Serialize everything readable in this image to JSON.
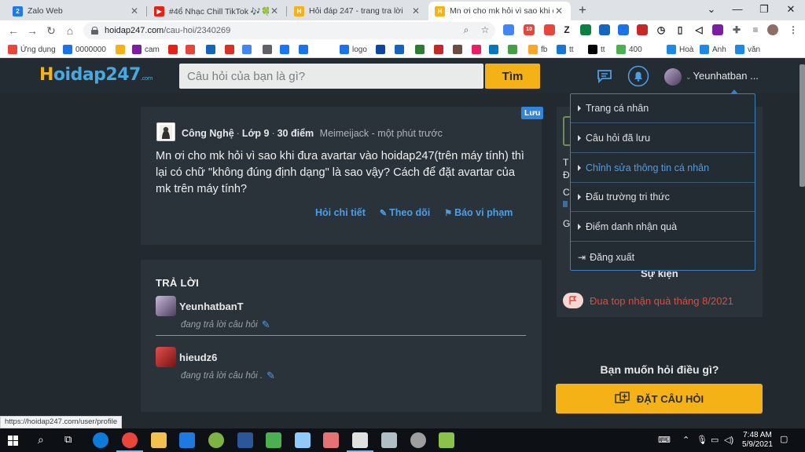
{
  "browser": {
    "tabs": [
      {
        "title": "Zalo Web",
        "favicon_color": "#1e7ae6",
        "favicon_badge": "2",
        "active": false
      },
      {
        "title": "#46̀ Nhạc Chill TikTok 🎶🍀 Đ",
        "favicon_color": "#e62117",
        "active": false
      },
      {
        "title": "Hỏi đáp 247 - trang tra lời",
        "favicon_color": "#f5b217",
        "active": false
      },
      {
        "title": "Mn ơi cho mk hỏi vì sao khi đưa",
        "favicon_color": "#f5b217",
        "active": true
      }
    ],
    "new_tab_symbol": "+",
    "window_controls": {
      "minimize": "—",
      "maximize": "❐",
      "close": "✕"
    },
    "address": {
      "domain": "hoidap247.com",
      "path": "/cau-hoi/2340269"
    },
    "extension_badge": "10"
  },
  "bookmarks": [
    {
      "label": "Ứng dụng",
      "color": "#e8453c"
    },
    {
      "label": "0000000",
      "color": "#1a73e8"
    },
    {
      "label": "",
      "color": "#f5b217"
    },
    {
      "label": "cam",
      "color": "#7b1fa2"
    },
    {
      "label": "",
      "color": "#e62117"
    },
    {
      "label": "",
      "color": "#e8453c"
    },
    {
      "label": "",
      "color": "#1565c0"
    },
    {
      "label": "",
      "color": "#d93025"
    },
    {
      "label": "",
      "color": "#4285f4"
    },
    {
      "label": "",
      "color": "#5f6368"
    },
    {
      "label": "",
      "color": "#1877f2"
    },
    {
      "label": "",
      "color": "#1a73e8"
    },
    {
      "label": "logo",
      "color": "#1a73e8"
    },
    {
      "label": "",
      "color": "#0d47a1"
    },
    {
      "label": "",
      "color": "#1565c0"
    },
    {
      "label": "",
      "color": "#2e7d32"
    },
    {
      "label": "",
      "color": "#c62828"
    },
    {
      "label": "",
      "color": "#6d4c41"
    },
    {
      "label": "",
      "color": "#e91e63"
    },
    {
      "label": "",
      "color": "#0277bd"
    },
    {
      "label": "",
      "color": "#43a047"
    },
    {
      "label": "fb",
      "color": "#f9a825"
    },
    {
      "label": "tt",
      "color": "#1976d2"
    },
    {
      "label": "tt",
      "color": "#000000"
    },
    {
      "label": "400",
      "color": "#4caf50"
    },
    {
      "label": "Hoà",
      "color": "#1e88e5"
    },
    {
      "label": "Anh",
      "color": "#1e88e5"
    },
    {
      "label": "văn",
      "color": "#1e88e5"
    }
  ],
  "site": {
    "logo": {
      "h": "H",
      "rest": "oidap247",
      "dot": ".com"
    },
    "search": {
      "placeholder": "Câu hỏi của bạn là gì?",
      "button": "Tìm"
    },
    "user": {
      "name": "Yeunhatban ..."
    }
  },
  "question": {
    "subject": "Công Nghệ",
    "grade": "Lớp 9",
    "points": "30 điểm",
    "author_time": "Meimeijack - một phút trước",
    "body": "Mn ơi cho mk hỏi vì sao khi đưa avartar vào hoidap247(trên máy tính) thì lại có chữ \"không đúng định dạng\" là sao vậy? Cách để đặt avartar của mk trên máy tính?",
    "actions": {
      "detail": "Hỏi chi tiết",
      "follow": "Theo dõi",
      "report": "Báo vi phạm"
    },
    "save_badge": "Lưu"
  },
  "answers": {
    "title": "TRẢ LỜI",
    "items": [
      {
        "name": "YeunhatbanT",
        "status": "đang trả lời câu hỏi"
      },
      {
        "name": "hieudz6",
        "status": "đang trả lời câu hỏi ."
      }
    ]
  },
  "user_menu": {
    "items": [
      "Trang cá nhân",
      "Câu hỏi đã lưu",
      "Chỉnh sửa thông tin cá nhân",
      "Đấu trường tri thức",
      "Điểm danh nhận quà"
    ],
    "logout": "Đăng xuất"
  },
  "sidebar": {
    "partial_letters": [
      "T",
      "Đ",
      "C",
      "G"
    ],
    "event_title": "Sự kiện",
    "event_item": "Đua top nhận quà tháng 8/2021",
    "ask_title": "Bạn muốn hỏi điều gì?",
    "ask_button": "ĐẶT CÂU HỎI"
  },
  "status_url": "https://hoidap247.com/user/profile",
  "taskbar": {
    "time": "7:48 AM",
    "date": "5/9/2021"
  },
  "colors": {
    "accent_yellow": "#f5b217",
    "link_blue": "#4e9ee6",
    "page_bg": "#232a2f",
    "card_bg": "#2b333a",
    "event_red": "#e0493d"
  }
}
